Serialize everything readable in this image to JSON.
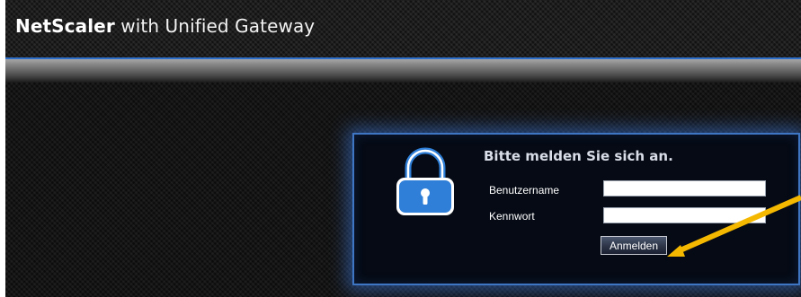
{
  "header": {
    "brand_bold": "NetScaler",
    "brand_rest": " with Unified Gateway"
  },
  "login": {
    "title": "Bitte melden Sie sich an.",
    "username_label": "Benutzername",
    "username_value": "",
    "password_label": "Kennwort",
    "password_value": "",
    "submit_label": "Anmelden"
  },
  "icons": {
    "lock": "lock-icon"
  },
  "colors": {
    "accent_blue": "#2e6fc9",
    "lock_blue": "#2f7fd8",
    "annotation_arrow": "#f5b800"
  }
}
